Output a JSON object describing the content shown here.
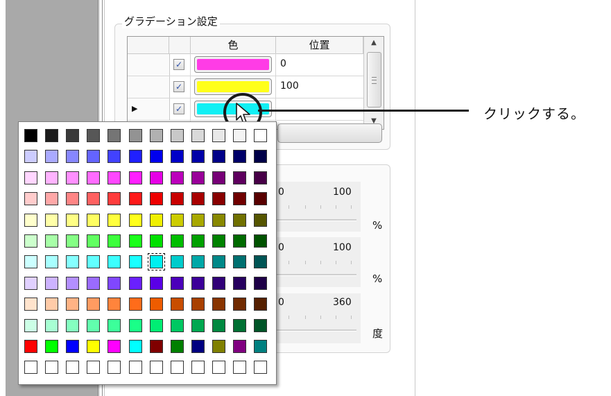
{
  "gradient_settings": {
    "title": "グラデーション設定",
    "columns": {
      "color": "色",
      "position": "位置"
    },
    "rows": [
      {
        "checked": true,
        "color": "#ff3ce6",
        "position": "0",
        "current": false
      },
      {
        "checked": true,
        "color": "#ffff1a",
        "position": "100",
        "current": false
      },
      {
        "checked": true,
        "color": "#11f0f4",
        "position": "",
        "current": true
      }
    ],
    "checkmark": "✓",
    "row_indicator": "▶"
  },
  "sliders": [
    {
      "min": "0",
      "max": "100",
      "unit": "%"
    },
    {
      "min": "0",
      "max": "100",
      "unit": "%"
    },
    {
      "min": "0",
      "max": "360",
      "unit": "度"
    }
  ],
  "callout": {
    "text": "クリックする。"
  },
  "palette": {
    "selected": {
      "row": 6,
      "col": 6
    },
    "rows": [
      [
        "#000000",
        "#1c1c1c",
        "#3a3a3a",
        "#575757",
        "#757575",
        "#939393",
        "#b1b1b1",
        "#c8c8c8",
        "#d9d9d9",
        "#e8e8e8",
        "#f4f4f4",
        "#ffffff"
      ],
      [
        "#ccccff",
        "#aaaaff",
        "#8787ff",
        "#6464ff",
        "#4242ff",
        "#2020ff",
        "#0000ee",
        "#0000c8",
        "#0000a8",
        "#000088",
        "#000068",
        "#000048"
      ],
      [
        "#ffd6ff",
        "#ffb3ff",
        "#ff8fff",
        "#ff6bff",
        "#ff47ff",
        "#ff20ff",
        "#e600e6",
        "#bb00bb",
        "#990099",
        "#770077",
        "#5e005e",
        "#470047"
      ],
      [
        "#ffcccc",
        "#ffa8a8",
        "#ff8585",
        "#ff6161",
        "#ff3c3c",
        "#ff1a1a",
        "#ee0000",
        "#c80000",
        "#a80000",
        "#880000",
        "#700000",
        "#580000"
      ],
      [
        "#ffffcc",
        "#ffffa8",
        "#ffff85",
        "#ffff61",
        "#ffff3c",
        "#ffff1a",
        "#f0f000",
        "#cccc00",
        "#a8a800",
        "#888800",
        "#707000",
        "#555500"
      ],
      [
        "#ccffcc",
        "#a8ffa8",
        "#85ff85",
        "#61ff61",
        "#3cff3c",
        "#1aff1a",
        "#00e000",
        "#00be00",
        "#00a000",
        "#008200",
        "#006a00",
        "#005200"
      ],
      [
        "#ccffff",
        "#a8ffff",
        "#85ffff",
        "#61ffff",
        "#3cffff",
        "#1affff",
        "#00f0f0",
        "#00cccc",
        "#00a8a8",
        "#008888",
        "#007070",
        "#005555"
      ],
      [
        "#e0d0ff",
        "#cdb3ff",
        "#b38fff",
        "#9a6bff",
        "#8047ff",
        "#6a20ff",
        "#5a00e6",
        "#4b00bb",
        "#3c0099",
        "#300077",
        "#26005e",
        "#1e0047"
      ],
      [
        "#ffe3cc",
        "#ffcba8",
        "#ffb385",
        "#ff9b61",
        "#ff843c",
        "#ff6c1a",
        "#ee5c00",
        "#c84d00",
        "#a84000",
        "#883400",
        "#702a00",
        "#552000"
      ],
      [
        "#ccffe6",
        "#a8ffd3",
        "#85ffc0",
        "#61ffad",
        "#3cff9a",
        "#1aff88",
        "#00ee74",
        "#00c862",
        "#00a850",
        "#008840",
        "#007033",
        "#005528"
      ],
      [
        "#ff0000",
        "#00ff00",
        "#0000ff",
        "#ffff00",
        "#ff00ff",
        "#00ffff",
        "#800000",
        "#008000",
        "#000080",
        "#808000",
        "#800080",
        "#008080"
      ],
      [
        "#ffffff",
        "#ffffff",
        "#ffffff",
        "#ffffff",
        "#ffffff",
        "#ffffff",
        "#ffffff",
        "#ffffff",
        "#ffffff",
        "#ffffff",
        "#ffffff",
        "#ffffff"
      ]
    ]
  }
}
